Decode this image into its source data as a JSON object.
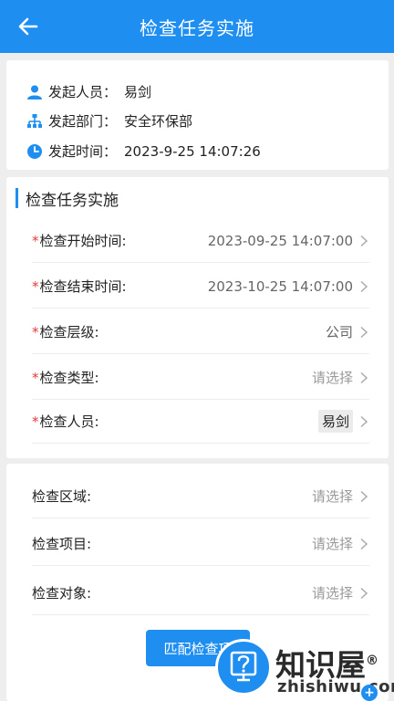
{
  "header": {
    "title": "检查任务实施"
  },
  "info": {
    "initiator_label": "发起人员：",
    "initiator_value": "易剑",
    "department_label": "发起部门：",
    "department_value": "安全环保部",
    "time_label": "发起时间：",
    "time_value": "2023-9-25 14:07:26"
  },
  "section": {
    "title": "检查任务实施"
  },
  "form": {
    "required_mark": "*",
    "start_time_label": "检查开始时间:",
    "start_time_value": "2023-09-25 14:07:00",
    "end_time_label": "检查结束时间:",
    "end_time_value": "2023-10-25 14:07:00",
    "level_label": "检查层级:",
    "level_value": "公司",
    "type_label": "检查类型:",
    "type_value": "请选择",
    "people_label": "检查人员:",
    "people_value": "易剑"
  },
  "form2": {
    "area_label": "检查区域:",
    "area_value": "请选择",
    "item_label": "检查项目:",
    "item_value": "请选择",
    "object_label": "检查对象:",
    "object_value": "请选择"
  },
  "button": {
    "label": "匹配检查项"
  },
  "watermark": {
    "name": "知识屋",
    "reg": "®",
    "domain": "zhishiwu.com",
    "plus": "+"
  },
  "colors": {
    "primary": "#1f8ef1",
    "required": "#e23b3b"
  }
}
